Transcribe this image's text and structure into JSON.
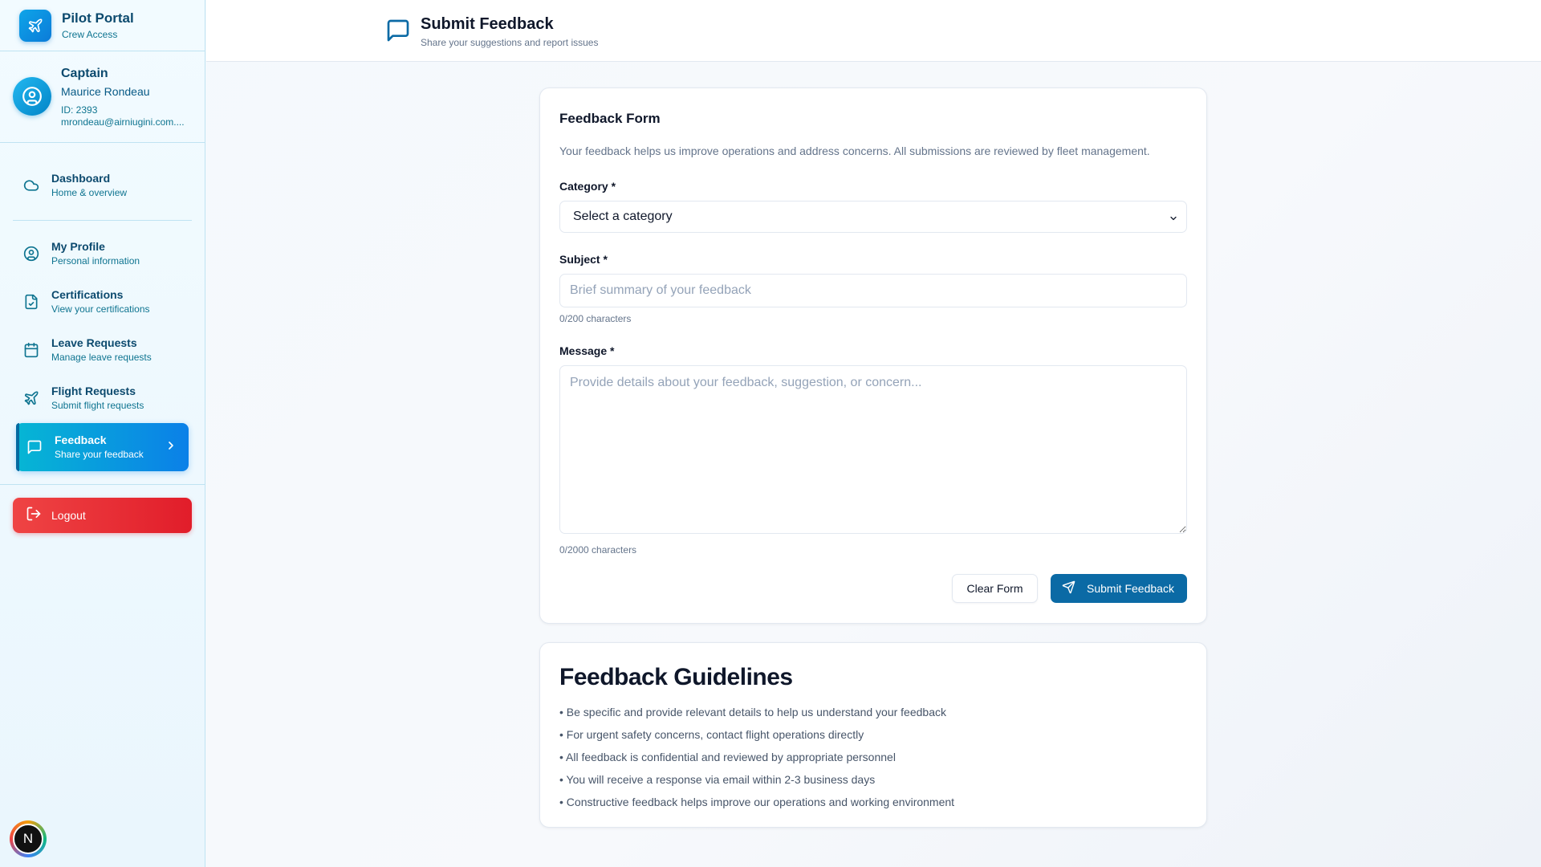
{
  "brand": {
    "title": "Pilot Portal",
    "subtitle": "Crew Access"
  },
  "user": {
    "rank": "Captain",
    "name": "Maurice Rondeau",
    "id": "ID: 2393",
    "email": "mrondeau@airniugini.com...."
  },
  "nav": {
    "items": [
      {
        "label": "Dashboard",
        "sub": "Home & overview",
        "icon": "cloud-icon"
      },
      {
        "label": "My Profile",
        "sub": "Personal information",
        "icon": "user-circle-icon"
      },
      {
        "label": "Certifications",
        "sub": "View your certifications",
        "icon": "file-check-icon"
      },
      {
        "label": "Leave Requests",
        "sub": "Manage leave requests",
        "icon": "calendar-icon"
      },
      {
        "label": "Flight Requests",
        "sub": "Submit flight requests",
        "icon": "plane-icon"
      },
      {
        "label": "Feedback",
        "sub": "Share your feedback",
        "icon": "message-square-icon",
        "active": true
      }
    ],
    "logout_label": "Logout"
  },
  "badge": {
    "letter": "N"
  },
  "header": {
    "title": "Submit Feedback",
    "subtitle": "Share your suggestions and report issues"
  },
  "form": {
    "title": "Feedback Form",
    "description": "Your feedback helps us improve operations and address concerns. All submissions are reviewed by fleet management.",
    "category_label": "Category *",
    "category_value": "Select a category",
    "subject_label": "Subject *",
    "subject_placeholder": "Brief summary of your feedback",
    "subject_counter": "0/200 characters",
    "message_label": "Message *",
    "message_placeholder": "Provide details about your feedback, suggestion, or concern...",
    "message_counter": "0/2000 characters",
    "clear_label": "Clear Form",
    "submit_label": "Submit Feedback"
  },
  "guidelines": {
    "title": "Feedback Guidelines",
    "items": [
      "• Be specific and provide relevant details to help us understand your feedback",
      "• For urgent safety concerns, contact flight operations directly",
      "• All feedback is confidential and reviewed by appropriate personnel",
      "• You will receive a response via email within 2-3 business days",
      "• Constructive feedback helps improve our operations and working environment"
    ]
  },
  "colors": {
    "accent": "#0b6aa5",
    "active_nav": "#0b80e8",
    "logout": "#e11d2a"
  }
}
